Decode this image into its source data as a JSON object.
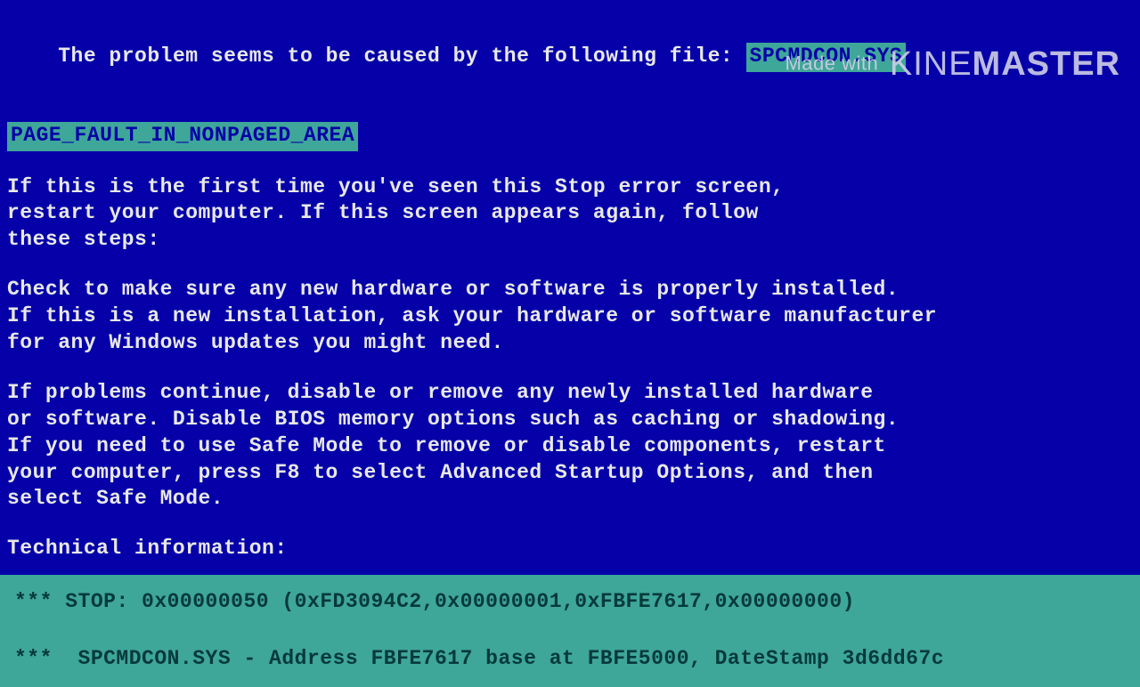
{
  "header": {
    "line1_prefix": "The problem seems to be caused by the following file: ",
    "file_highlight": "SPCMDCON.SYS",
    "error_highlight": "PAGE_FAULT_IN_NONPAGED_AREA"
  },
  "paragraphs": {
    "p1": "If this is the first time you've seen this Stop error screen,\nrestart your computer. If this screen appears again, follow\nthese steps:",
    "p2": "Check to make sure any new hardware or software is properly installed.\nIf this is a new installation, ask your hardware or software manufacturer\nfor any Windows updates you might need.",
    "p3": "If problems continue, disable or remove any newly installed hardware\nor software. Disable BIOS memory options such as caching or shadowing.\nIf you need to use Safe Mode to remove or disable components, restart\nyour computer, press F8 to select Advanced Startup Options, and then\nselect Safe Mode.",
    "tech_label": "Technical information:"
  },
  "technical": {
    "stop_line": "*** STOP: 0x00000050 (0xFD3094C2,0x00000001,0xFBFE7617,0x00000000)",
    "addr_line": "***  SPCMDCON.SYS - Address FBFE7617 base at FBFE5000, DateStamp 3d6dd67c"
  },
  "watermark": {
    "prefix": "Made with ",
    "brand1": "KINE",
    "brand2": "MASTER"
  }
}
